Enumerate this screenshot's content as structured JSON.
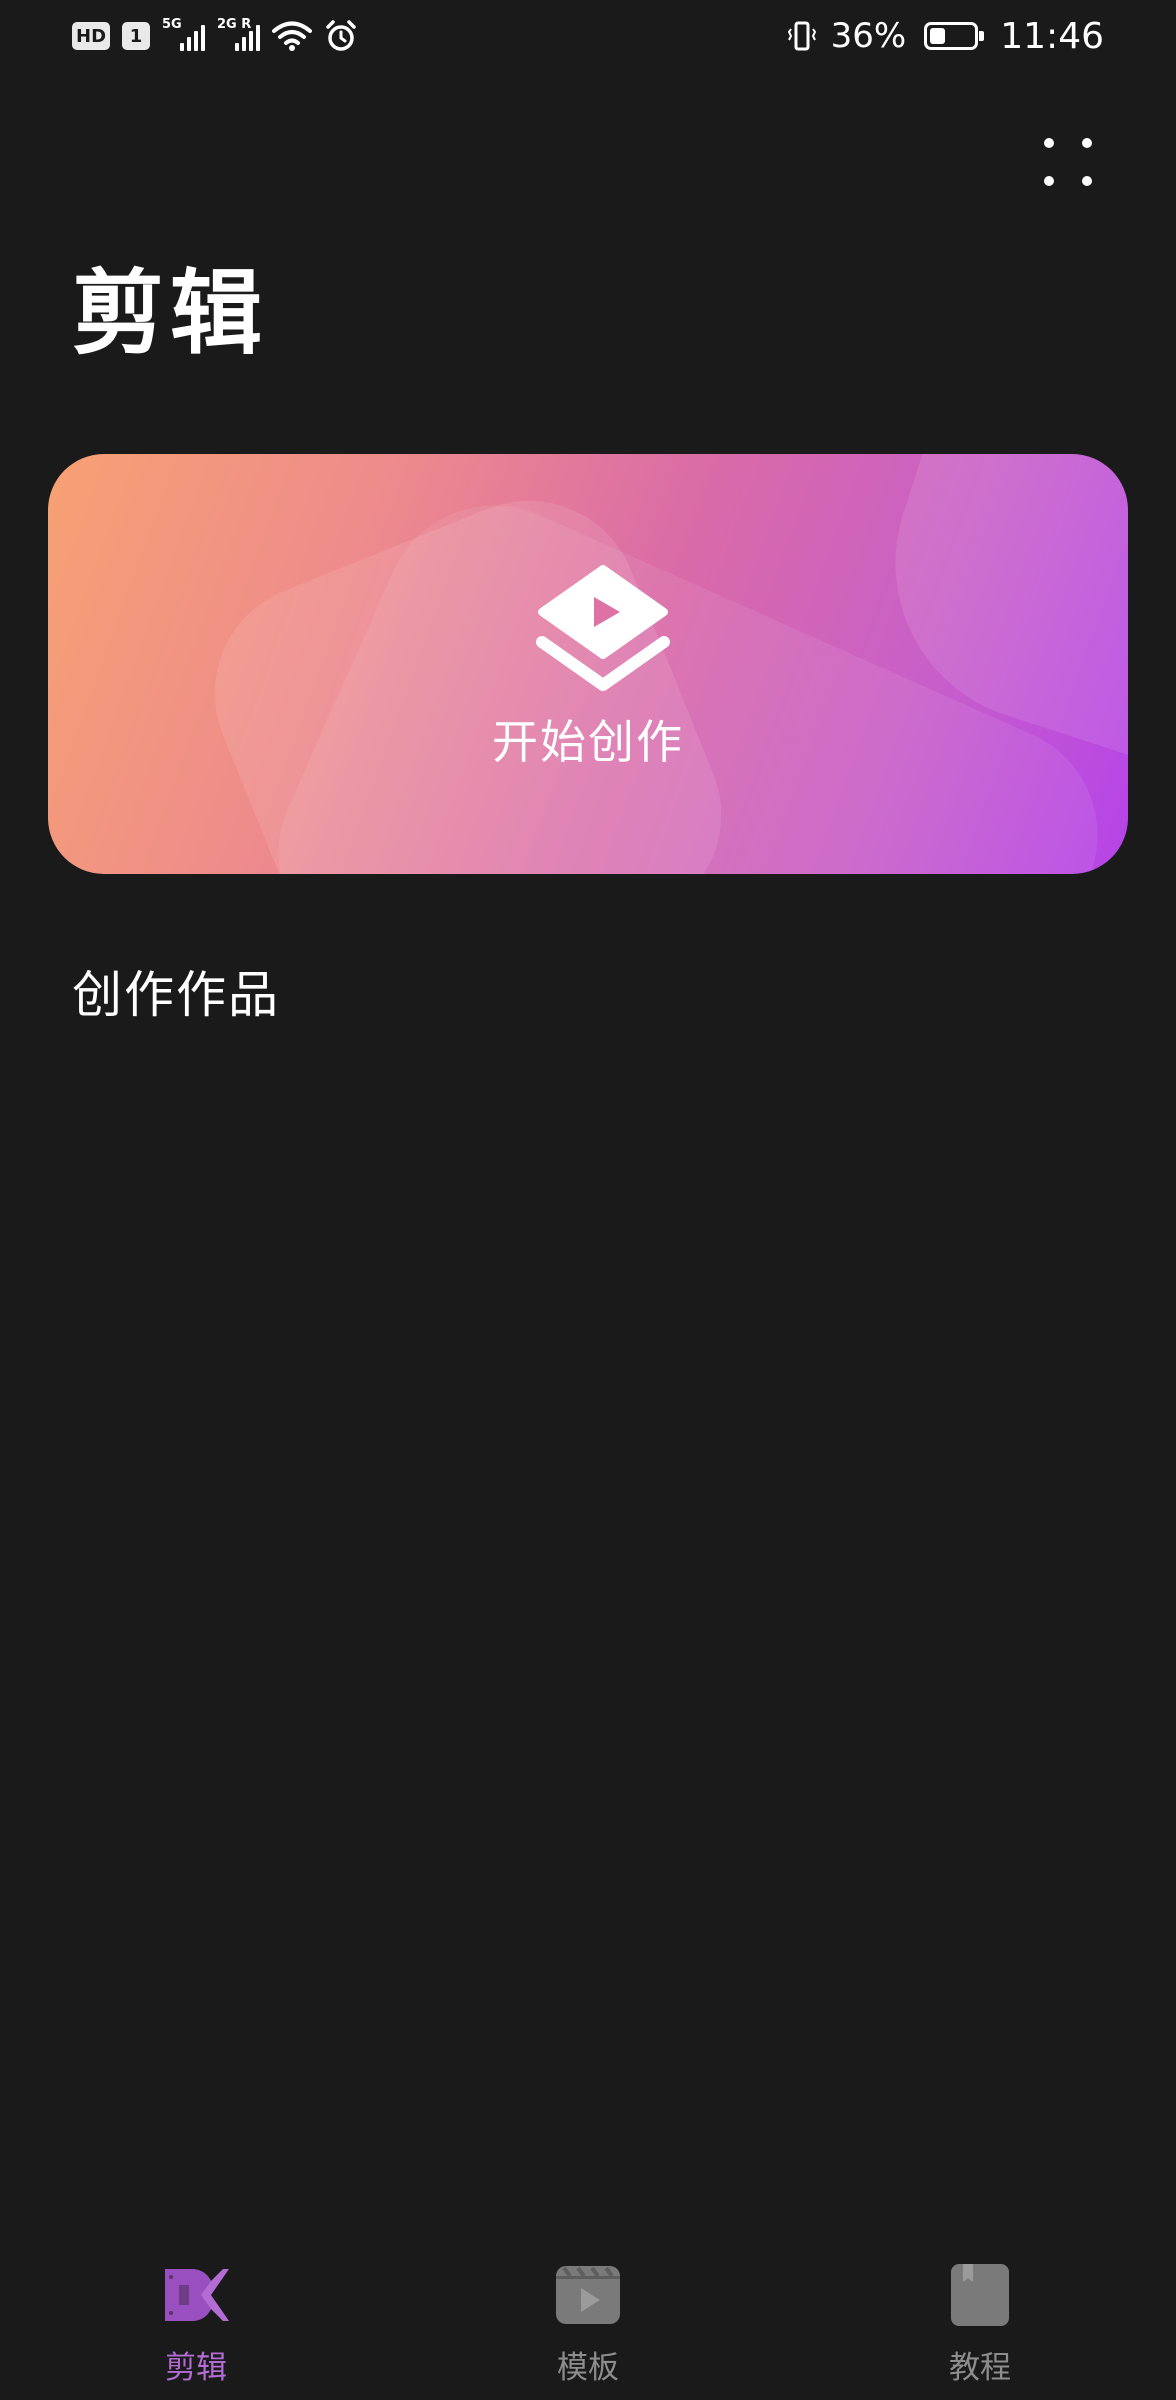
{
  "status_bar": {
    "hd_badge": "HD",
    "sim_badge": "1",
    "network_1": "5G",
    "network_2": "2G R",
    "battery_percent": "36%",
    "battery_level": 0.36,
    "time": "11:46"
  },
  "header": {
    "title": "剪辑",
    "more_icon": "more-dots-icon"
  },
  "start_card": {
    "label": "开始创作",
    "icon": "layers-play-icon",
    "gradient": [
      "#f7a173",
      "#d96aa8",
      "#b543e8"
    ]
  },
  "section": {
    "title": "创作作品"
  },
  "bottom_nav": {
    "items": [
      {
        "label": "剪辑",
        "icon": "edit-logo-icon",
        "active": true
      },
      {
        "label": "模板",
        "icon": "template-icon",
        "active": false
      },
      {
        "label": "教程",
        "icon": "tutorial-icon",
        "active": false
      }
    ],
    "active_color": "#b36cd3",
    "inactive_color": "#8d8d8d"
  }
}
